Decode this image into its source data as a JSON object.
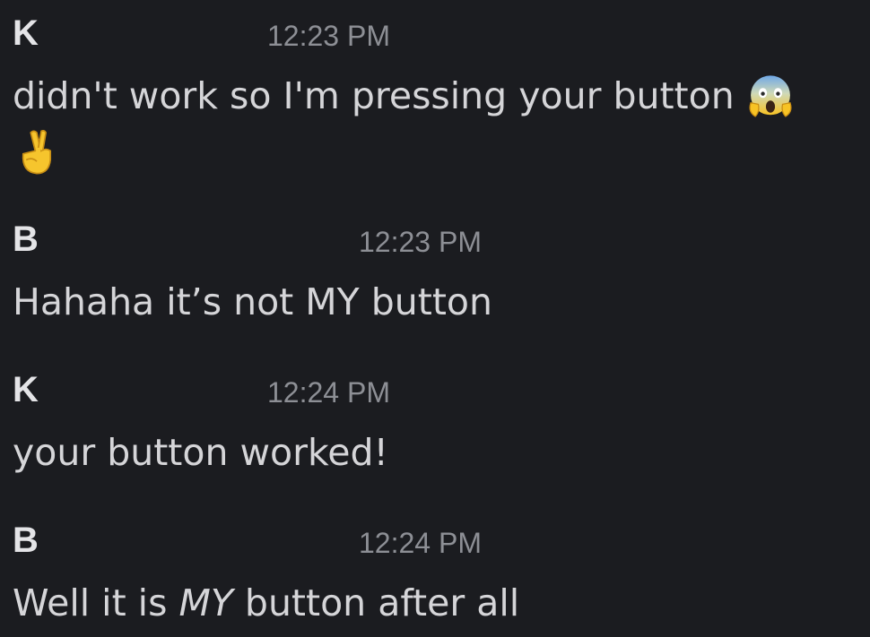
{
  "messages": [
    {
      "sender": "K",
      "time": "12:23 PM",
      "text": "didn't work so I'm pressing your button",
      "emoji": [
        "face-screaming-in-fear-icon",
        "crossed-fingers-icon"
      ]
    },
    {
      "sender": "B",
      "time": "12:23 PM",
      "text": "Hahaha it’s not MY button"
    },
    {
      "sender": "K",
      "time": "12:24 PM",
      "text": "your button worked!"
    },
    {
      "sender": "B",
      "time": "12:24 PM",
      "text_prefix": "Well it is ",
      "text_emphasis": "MY",
      "text_suffix": " button after all"
    }
  ],
  "colors": {
    "background": "#1b1c20",
    "text": "#d5d5d8",
    "sender": "#e4e4e7",
    "timestamp": "#8d8f95"
  }
}
